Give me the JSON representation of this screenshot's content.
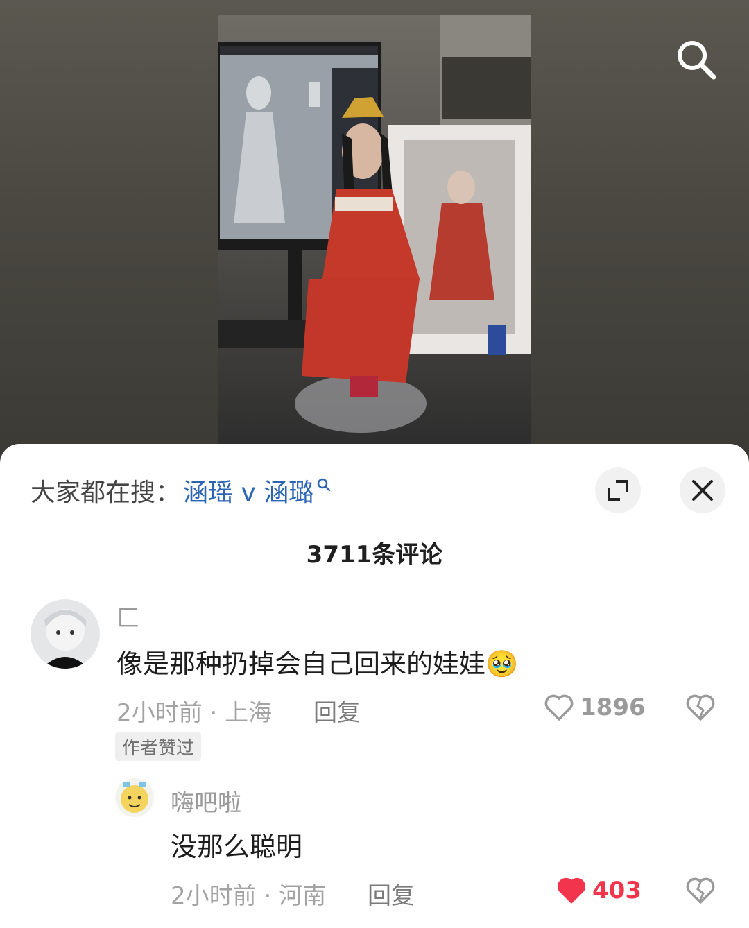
{
  "hot_search": {
    "label": "大家都在搜：",
    "term": "涵瑶 v 涵璐"
  },
  "comment_count": "3711条评论",
  "comments": [
    {
      "username": "匚",
      "content": "像是那种扔掉会自己回来的娃娃",
      "emoji": "🥹",
      "time": "2小时前",
      "location": "上海",
      "reply_label": "回复",
      "likes": "1896",
      "liked": false,
      "badge": "作者赞过"
    },
    {
      "username": "嗨吧啦",
      "content": "没那么聪明",
      "time": "2小时前",
      "location": "河南",
      "reply_label": "回复",
      "likes": "403",
      "liked": true
    }
  ],
  "colors": {
    "link_blue": "#2b64b2",
    "like_red": "#f2344c",
    "meta_gray": "#a3a3a3"
  },
  "icons": [
    "search-icon",
    "expand-icon",
    "close-icon",
    "heart-icon",
    "heart-filled-icon",
    "broken-heart-icon",
    "search-small-icon"
  ]
}
